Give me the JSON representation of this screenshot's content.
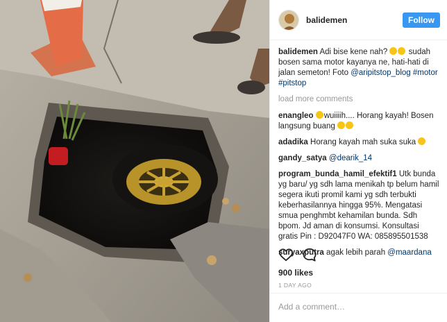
{
  "post": {
    "username": "balidemen",
    "follow_label": "Follow",
    "caption": {
      "user": "balidemen",
      "text_before": "Adi bise kene nah? ",
      "text_after": " sudah bosen sama motor kayanya ne, hati-hati di jalan semeton! Foto ",
      "mention": "@aripitstop_blog",
      "tags": [
        "#motor",
        "#pitstop"
      ]
    },
    "load_more": "load more comments",
    "comments": [
      {
        "user": "enangleo",
        "text_before": "",
        "text": "wuiiiih.... Horang kayah! Bosen langsung buang",
        "text_after": ""
      },
      {
        "user": "adadika",
        "text": "Horang kayah mah suka suka "
      },
      {
        "user": "gandy_satya",
        "mention": "@dearik_14"
      },
      {
        "user": "program_bunda_hamil_efektif1",
        "text": "Utk bunda yg baru/ yg sdh lama menikah tp belum hamil segera ikuti promil kami yg sdh terbukti keberhasilannya hingga 95%. Mengatasi smua penghmbt kehamilan bunda. Sdh bpom. Jd aman di konsumsi. Konsultasi gratis Pin : D92047F0 WA: 085895501538"
      },
      {
        "user": "suryaxputra",
        "text": "agak lebih parah ",
        "mention": "@maardana"
      }
    ],
    "likes": "900 likes",
    "time_ago": "1 DAY AGO",
    "add_comment_placeholder": "Add a comment…"
  },
  "icons": [
    "heart-icon",
    "comment-icon"
  ],
  "colors": {
    "accent": "#3897f0",
    "link": "#003569",
    "muted": "#999999"
  }
}
